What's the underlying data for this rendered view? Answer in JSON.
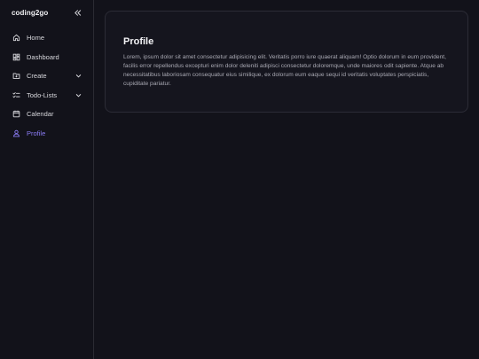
{
  "app": {
    "brand": "coding2go"
  },
  "sidebar": {
    "items": [
      {
        "label": "Home",
        "icon": "home-icon"
      },
      {
        "label": "Dashboard",
        "icon": "dashboard-icon"
      },
      {
        "label": "Create",
        "icon": "create-folder-icon",
        "expandable": true
      },
      {
        "label": "Todo-Lists",
        "icon": "checklist-icon",
        "expandable": true
      },
      {
        "label": "Calendar",
        "icon": "calendar-icon"
      },
      {
        "label": "Profile",
        "icon": "user-icon",
        "active": true
      }
    ]
  },
  "main": {
    "card": {
      "title": "Profile",
      "text": "Lorem, ipsum dolor sit amet consectetur adipisicing elit. Veritatis porro iure quaerat aliquam! Optio dolorum in eum provident, facilis error repellendus excepturi enim dolor deleniti adipisci consectetur doloremque, unde maiores odit sapiente. Atque ab necessitatibus laboriosam consequatur eius similique, ex dolorum eum eaque sequi id veritatis voluptates perspiciatis, cupiditate pariatur."
    }
  },
  "colors": {
    "background": "#12121a",
    "accent": "#8b7cf6",
    "border": "#2a2a33"
  }
}
